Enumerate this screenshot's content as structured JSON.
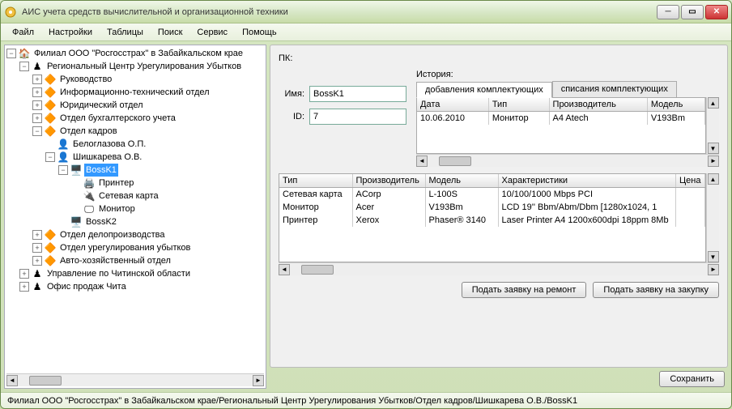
{
  "window": {
    "title": "АИС учета средств вычислительной и организационной техники"
  },
  "menubar": [
    "Файл",
    "Настройки",
    "Таблицы",
    "Поиск",
    "Сервис",
    "Помощь"
  ],
  "tree": {
    "root": "Филиал ООО \"Росгосстрах\" в Забайкальском крае",
    "regional": "Региональный Центр Урегулирования Убытков",
    "depts": {
      "rukovodstvo": "Руководство",
      "info_tech": "Информационно-технический отдел",
      "juridical": "Юридический отдел",
      "accounting": "Отдел бухгалтерского учета",
      "kadry": "Отдел кадров",
      "beloglazova": "Белоглазова О.П.",
      "shishkareva": "Шишкарева О.В.",
      "bossk1": "BossK1",
      "printer": "Принтер",
      "netcard": "Сетевая карта",
      "monitor": "Монитор",
      "bossk2": "BossK2",
      "deloproizvodstvo": "Отдел делопроизводства",
      "uregulirovanie": "Отдел урегулирования убытков",
      "avtohoz": "Авто-хозяйственный отдел",
      "chita_region": "Управление по Читинской области",
      "office_chita": "Офис продаж Чита"
    }
  },
  "detail": {
    "header": "ПК:",
    "name_label": "Имя:",
    "name_value": "BossK1",
    "id_label": "ID:",
    "id_value": "7",
    "history_label": "История:",
    "tabs": {
      "add": "добавления комплектующих",
      "writeoff": "списания комплектующих"
    },
    "history_table": {
      "cols": [
        "Дата",
        "Тип",
        "Производитель",
        "Модель"
      ],
      "rows": [
        [
          "10.06.2010",
          "Монитор",
          "A4 Atech",
          "V193Bm"
        ]
      ]
    },
    "components_table": {
      "cols": [
        "Тип",
        "Производитель",
        "Модель",
        "Характеристики",
        "Цена"
      ],
      "rows": [
        [
          "Сетевая карта",
          "ACorp",
          "L-100S",
          "10/100/1000 Mbps PCI",
          ""
        ],
        [
          "Монитор",
          "Acer",
          "V193Bm",
          " LCD 19''   Bbm/Abm/Dbm [1280x1024, 1",
          ""
        ],
        [
          "Принтер",
          "Xerox",
          "Phaser® 3140",
          " Laser Printer A4 1200x600dpi 18ppm 8Mb",
          ""
        ]
      ]
    },
    "buttons": {
      "repair": "Подать заявку на ремонт",
      "purchase": "Подать заявку на закупку",
      "save": "Сохранить"
    }
  },
  "statusbar": "Филиал ООО \"Росгосстрах\" в Забайкальском крае/Региональный Центр Урегулирования Убытков/Отдел кадров/Шишкарева О.В./BossK1"
}
